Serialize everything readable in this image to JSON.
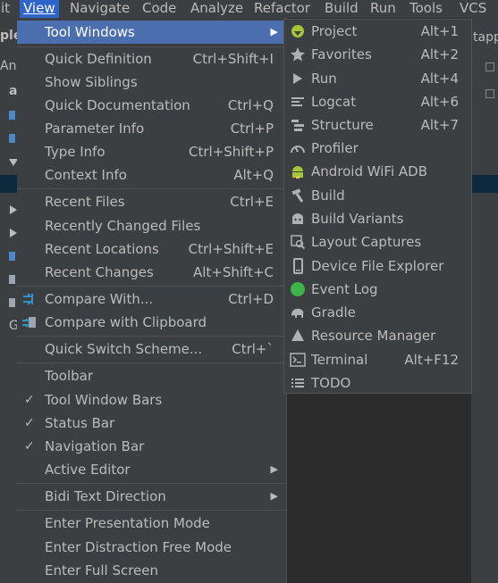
{
  "menubar": {
    "items": [
      {
        "label": "it"
      },
      {
        "label": "View"
      },
      {
        "label": "Navigate"
      },
      {
        "label": "Code"
      },
      {
        "label": "Analyze"
      },
      {
        "label": "Refactor"
      },
      {
        "label": "Build"
      },
      {
        "label": "Run"
      },
      {
        "label": "Tools"
      },
      {
        "label": "VCS"
      }
    ]
  },
  "background": {
    "left_fragments": [
      "ple",
      "An",
      "a",
      "G"
    ],
    "right_fragments": [
      "tapp"
    ]
  },
  "view_menu": {
    "items": [
      {
        "label": "Tool Windows",
        "shortcut": "",
        "submenu": true,
        "selected": true
      },
      {
        "label": "Quick Definition",
        "shortcut": "Ctrl+Shift+I"
      },
      {
        "label": "Show Siblings",
        "shortcut": ""
      },
      {
        "label": "Quick Documentation",
        "shortcut": "Ctrl+Q"
      },
      {
        "label": "Parameter Info",
        "shortcut": "Ctrl+P"
      },
      {
        "label": "Type Info",
        "shortcut": "Ctrl+Shift+P"
      },
      {
        "label": "Context Info",
        "shortcut": "Alt+Q"
      },
      {
        "label": "Recent Files",
        "shortcut": "Ctrl+E"
      },
      {
        "label": "Recently Changed Files",
        "shortcut": ""
      },
      {
        "label": "Recent Locations",
        "shortcut": "Ctrl+Shift+E"
      },
      {
        "label": "Recent Changes",
        "shortcut": "Alt+Shift+C"
      },
      {
        "label": "Compare With...",
        "shortcut": "Ctrl+D",
        "icon": "compare-icon"
      },
      {
        "label": "Compare with Clipboard",
        "shortcut": "",
        "icon": "compare-clipboard-icon"
      },
      {
        "label": "Quick Switch Scheme...",
        "shortcut": "Ctrl+`"
      },
      {
        "label": "Toolbar",
        "shortcut": "",
        "checked": false
      },
      {
        "label": "Tool Window Bars",
        "shortcut": "",
        "checked": true
      },
      {
        "label": "Status Bar",
        "shortcut": "",
        "checked": true
      },
      {
        "label": "Navigation Bar",
        "shortcut": "",
        "checked": true
      },
      {
        "label": "Active Editor",
        "shortcut": "",
        "submenu": true
      },
      {
        "label": "Bidi Text Direction",
        "shortcut": "",
        "submenu": true
      },
      {
        "label": "Enter Presentation Mode",
        "shortcut": ""
      },
      {
        "label": "Enter Distraction Free Mode",
        "shortcut": ""
      },
      {
        "label": "Enter Full Screen",
        "shortcut": ""
      }
    ]
  },
  "tool_windows_submenu": {
    "items": [
      {
        "label": "Project",
        "shortcut": "Alt+1",
        "icon": "android-project-icon"
      },
      {
        "label": "Favorites",
        "shortcut": "Alt+2",
        "icon": "star-icon"
      },
      {
        "label": "Run",
        "shortcut": "Alt+4",
        "icon": "play-icon"
      },
      {
        "label": "Logcat",
        "shortcut": "Alt+6",
        "icon": "logcat-icon"
      },
      {
        "label": "Structure",
        "shortcut": "Alt+7",
        "icon": "structure-icon"
      },
      {
        "label": "Profiler",
        "shortcut": "",
        "icon": "gauge-icon"
      },
      {
        "label": "Android WiFi ADB",
        "shortcut": "",
        "icon": "android-robot-icon"
      },
      {
        "label": "Build",
        "shortcut": "",
        "icon": "hammer-icon"
      },
      {
        "label": "Build Variants",
        "shortcut": "",
        "icon": "build-variants-icon"
      },
      {
        "label": "Layout Captures",
        "shortcut": "",
        "icon": "layout-capture-icon"
      },
      {
        "label": "Device File Explorer",
        "shortcut": "",
        "icon": "phone-icon"
      },
      {
        "label": "Event Log",
        "shortcut": "",
        "icon": "event-log-icon"
      },
      {
        "label": "Gradle",
        "shortcut": "",
        "icon": "gradle-elephant-icon"
      },
      {
        "label": "Resource Manager",
        "shortcut": "",
        "icon": "resource-manager-icon"
      },
      {
        "label": "Terminal",
        "shortcut": "Alt+F12",
        "icon": "terminal-icon"
      },
      {
        "label": "TODO",
        "shortcut": "",
        "icon": "todo-list-icon"
      }
    ]
  },
  "colors": {
    "menu_bg": "#3c3f41",
    "selection": "#4b6eaf",
    "menubar_active": "#2f65ca",
    "text": "#bbbbbb",
    "android_green": "#a4c639",
    "event_log_green": "#3eb34a"
  }
}
